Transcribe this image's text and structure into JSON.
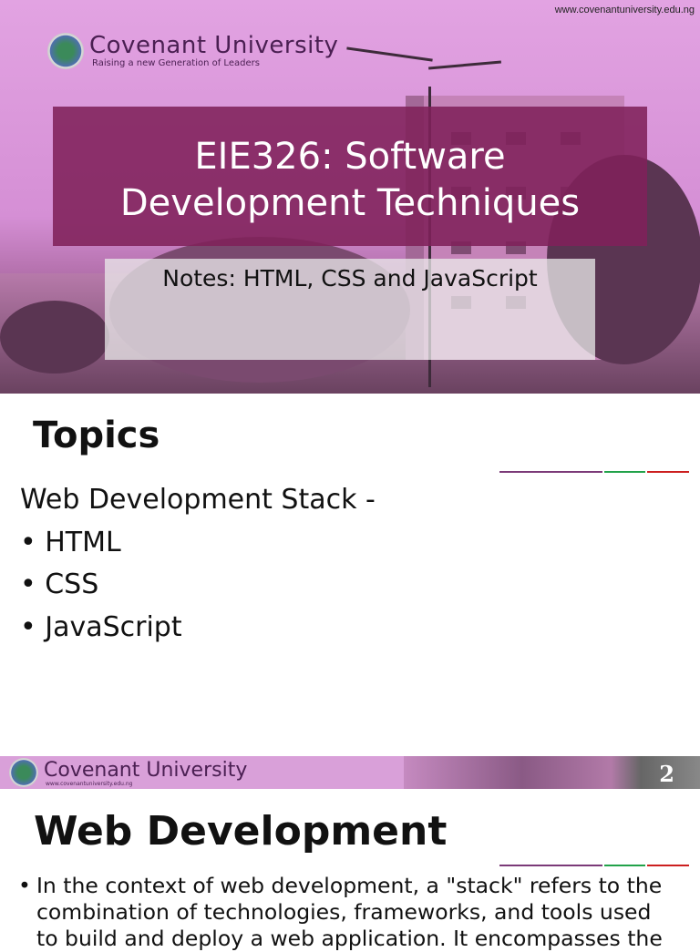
{
  "slide1": {
    "url": "www.covenantuniversity.edu.ng",
    "logo_name": "Covenant University",
    "logo_tagline": "Raising a new Generation of Leaders",
    "title_line1": "EIE326: Software",
    "title_line2": "Development Techniques",
    "subtitle": "Notes: HTML, CSS and JavaScript"
  },
  "slide2": {
    "heading": "Topics",
    "intro": "Web Development Stack -",
    "items": [
      "HTML",
      "CSS",
      "JavaScript"
    ]
  },
  "slide3": {
    "logo_name": "Covenant University",
    "logo_url": "www.covenantuniversity.edu.ng",
    "page_number": "2",
    "heading": "Web Development",
    "bullet_lines": [
      "In the context of web development, a \"stack\" refers to the",
      "combination of technologies, frameworks, and tools used",
      "to build and deploy a web application. It encompasses the"
    ]
  },
  "colors": {
    "purple": "#7b3a78",
    "green": "#22a24a",
    "red": "#cc1f1f",
    "title_box": "#80215a"
  }
}
